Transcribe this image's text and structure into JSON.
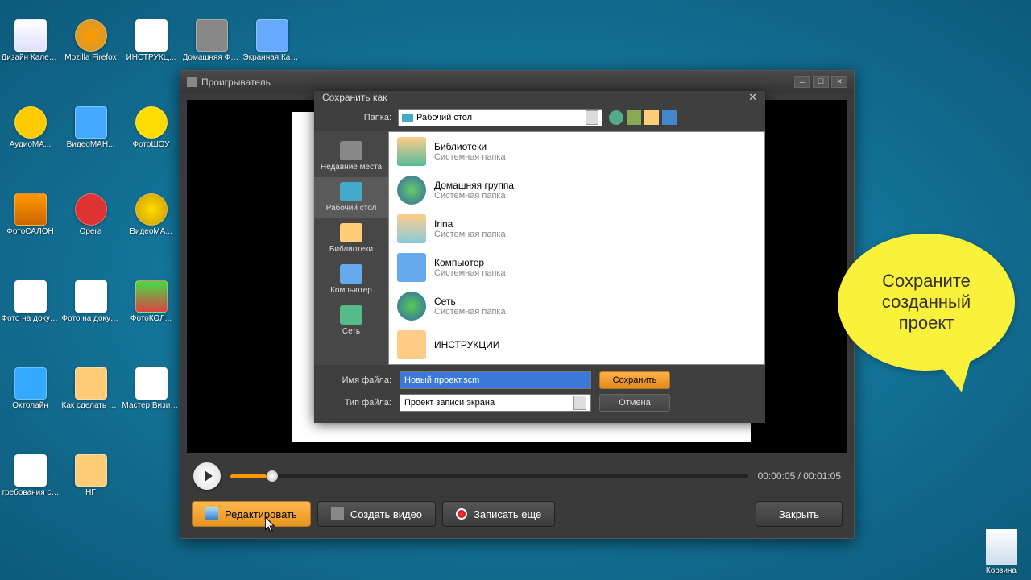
{
  "desktop": {
    "icons": [
      {
        "label": "Дизайн Календарей"
      },
      {
        "label": "Mozilla Firefox"
      },
      {
        "label": "ИНСТРУКЦ..."
      },
      {
        "label": "Домашняя Фотостудия"
      },
      {
        "label": "Экранная Камера"
      },
      {
        "label": "АудиоМА..."
      },
      {
        "label": "ВидеоМАН..."
      },
      {
        "label": "ФотоШОУ"
      },
      {
        "label": "ФотоСАЛОН"
      },
      {
        "label": "Opera"
      },
      {
        "label": "ВидеоМА..."
      },
      {
        "label": "Фото на документ..."
      },
      {
        "label": "Фото на документ..."
      },
      {
        "label": "ФотоКОЛ..."
      },
      {
        "label": "Октолайн"
      },
      {
        "label": "Как сделать слайд-шоу..."
      },
      {
        "label": "Мастер Визиток"
      },
      {
        "label": "требования статьям.d..."
      },
      {
        "label": "НГ"
      }
    ],
    "recycle_label": "Корзина"
  },
  "player": {
    "title": "Проигрыватель",
    "time": "00:00:05 / 00:01:05",
    "buttons": {
      "edit": "Редактировать",
      "create": "Создать видео",
      "record": "Записать еще",
      "close": "Закрыть"
    }
  },
  "save_dialog": {
    "title": "Сохранить как",
    "folder_label": "Папка:",
    "folder_value": "Рабочий стол",
    "places": {
      "recent": "Недавние места",
      "desktop": "Рабочий стол",
      "libraries": "Библиотеки",
      "computer": "Компьютер",
      "network": "Сеть"
    },
    "items": [
      {
        "name": "Библиотеки",
        "type": "Системная папка"
      },
      {
        "name": "Домашняя группа",
        "type": "Системная папка"
      },
      {
        "name": "Irina",
        "type": "Системная папка"
      },
      {
        "name": "Компьютер",
        "type": "Системная папка"
      },
      {
        "name": "Сеть",
        "type": "Системная папка"
      },
      {
        "name": "ИНСТРУКЦИИ",
        "type": ""
      }
    ],
    "filename_label": "Имя файла:",
    "filename_value": "Новый проект.scm",
    "filetype_label": "Тип файла:",
    "filetype_value": "Проект записи экрана",
    "save_btn": "Сохранить",
    "cancel_btn": "Отмена"
  },
  "callout": {
    "text": "Сохраните созданный проект"
  }
}
